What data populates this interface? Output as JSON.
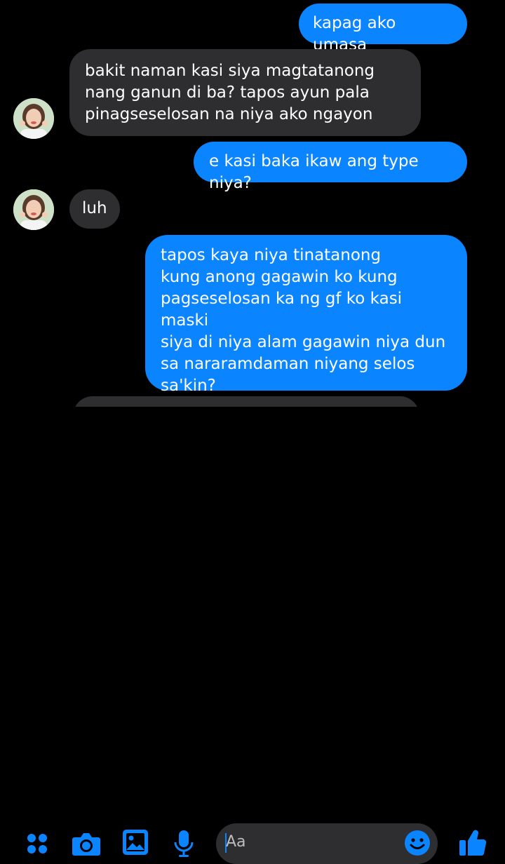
{
  "messages": [
    {
      "side": "out",
      "text": "kapag ako umasa"
    },
    {
      "side": "in",
      "text": "bakit naman kasi siya magtatanong\nnang ganun di ba? tapos ayun pala\npinagseselosan na niya ako ngayon"
    },
    {
      "side": "out",
      "text": "e kasi baka ikaw ang type niya?"
    },
    {
      "side": "in",
      "text": "luh"
    },
    {
      "side": "out",
      "text": "tapos kaya niya tinatanong\nkung anong gagawin ko kung\npagseselosan ka ng gf ko kasi maski\nsiya di niya alam gagawin niya dun\nsa nararamdaman niyang selos\nsa'kin?"
    }
  ],
  "composer": {
    "placeholder": "Aa",
    "icons": [
      "more-icon",
      "camera-icon",
      "gallery-icon",
      "microphone-icon",
      "emoji-icon",
      "thumbs-up-icon"
    ]
  },
  "colors": {
    "outgoing_bubble": "#0a84ff",
    "incoming_bubble": "#2e2e30",
    "accent": "#0a84ff",
    "background": "#000000"
  }
}
